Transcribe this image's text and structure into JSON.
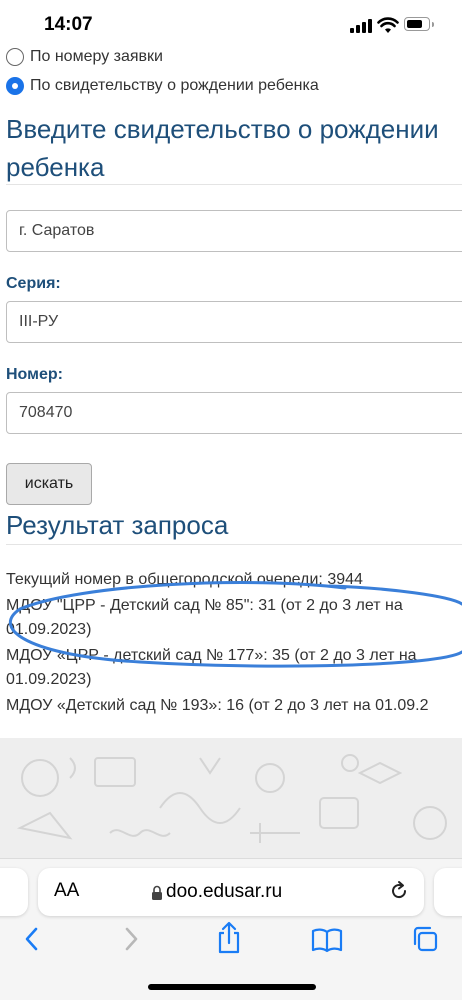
{
  "status_bar": {
    "time": "14:07"
  },
  "search_mode": {
    "option_request": "По номеру заявки",
    "option_certificate": "По свидетельству о рождении ребенка",
    "selected": "certificate"
  },
  "form": {
    "title_line1": "Введите свидетельство о рождении",
    "title_line2": "ребенка",
    "city_value": "г. Саратов",
    "series_label": "Серия:",
    "series_value": "III-РУ",
    "number_label": "Номер:",
    "number_value": "708470",
    "search_button": "искать"
  },
  "results": {
    "title": "Результат запроса",
    "lines": [
      "Текущий номер в общегородской очереди: 3944",
      "МДОУ \"ЦРР - Детский сад № 85\": 31 (от 2 до 3 лет на",
      "01.09.2023)",
      "МДОУ «ЦРР - детский сад № 177»: 35 (от 2 до 3 лет на",
      "01.09.2023)",
      "МДОУ «Детский сад № 193»: 16 (от 2 до 3 лет на 01.09.2"
    ],
    "highlight_color": "#3a7fd9"
  },
  "browser": {
    "text_size_button": "AA",
    "url": "doo.edusar.ru"
  },
  "colors": {
    "heading": "#1e4f7a",
    "radio_selected": "#1a73e8",
    "safari_blue": "#1a7cf5"
  }
}
